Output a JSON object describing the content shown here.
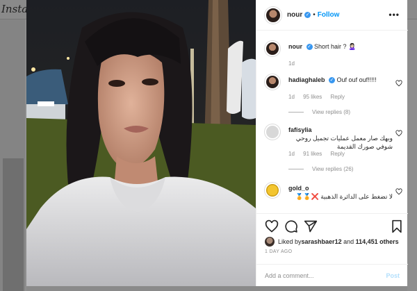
{
  "background": {
    "logo": "Insta"
  },
  "post": {
    "author": "nour",
    "follow_label": "Follow",
    "more_label": "•••",
    "caption": {
      "user": "nour",
      "text": "Short hair ? 🙎🏻‍♀️",
      "time": "1d"
    },
    "comments": [
      {
        "user": "hadiaghaleb",
        "text": "Ouf ouf ouf!!!!!",
        "time": "1d",
        "likes": "95 likes",
        "reply": "Reply",
        "view_replies": "View replies (8)"
      },
      {
        "user": "fafisylia",
        "text": "وبهك صار معمل عمليات تجميل روحي شوفي صورك القديمة",
        "time": "1d",
        "likes": "91 likes",
        "reply": "Reply",
        "view_replies": "View replies (26)"
      },
      {
        "user": "gold_o",
        "text": "لا تضغط على الدائرة الذهبية ❌🏅🏅",
        "time": "",
        "likes": "",
        "reply": "",
        "view_replies": ""
      }
    ],
    "liked_by_prefix": "Liked by ",
    "liked_by_user": "sarashbaer12",
    "liked_by_and": " and ",
    "liked_by_count": "114,451 others",
    "date": "1 DAY AGO",
    "comment_placeholder": "Add a comment...",
    "post_label": "Post"
  },
  "icons": {
    "like": "heart-icon",
    "comment": "comment-icon",
    "share": "share-icon",
    "save": "bookmark-icon",
    "verified": "verified-badge-icon"
  },
  "colors": {
    "link_blue": "#0095f6",
    "verified_blue": "#3897f0",
    "muted": "#8e8e8e"
  }
}
